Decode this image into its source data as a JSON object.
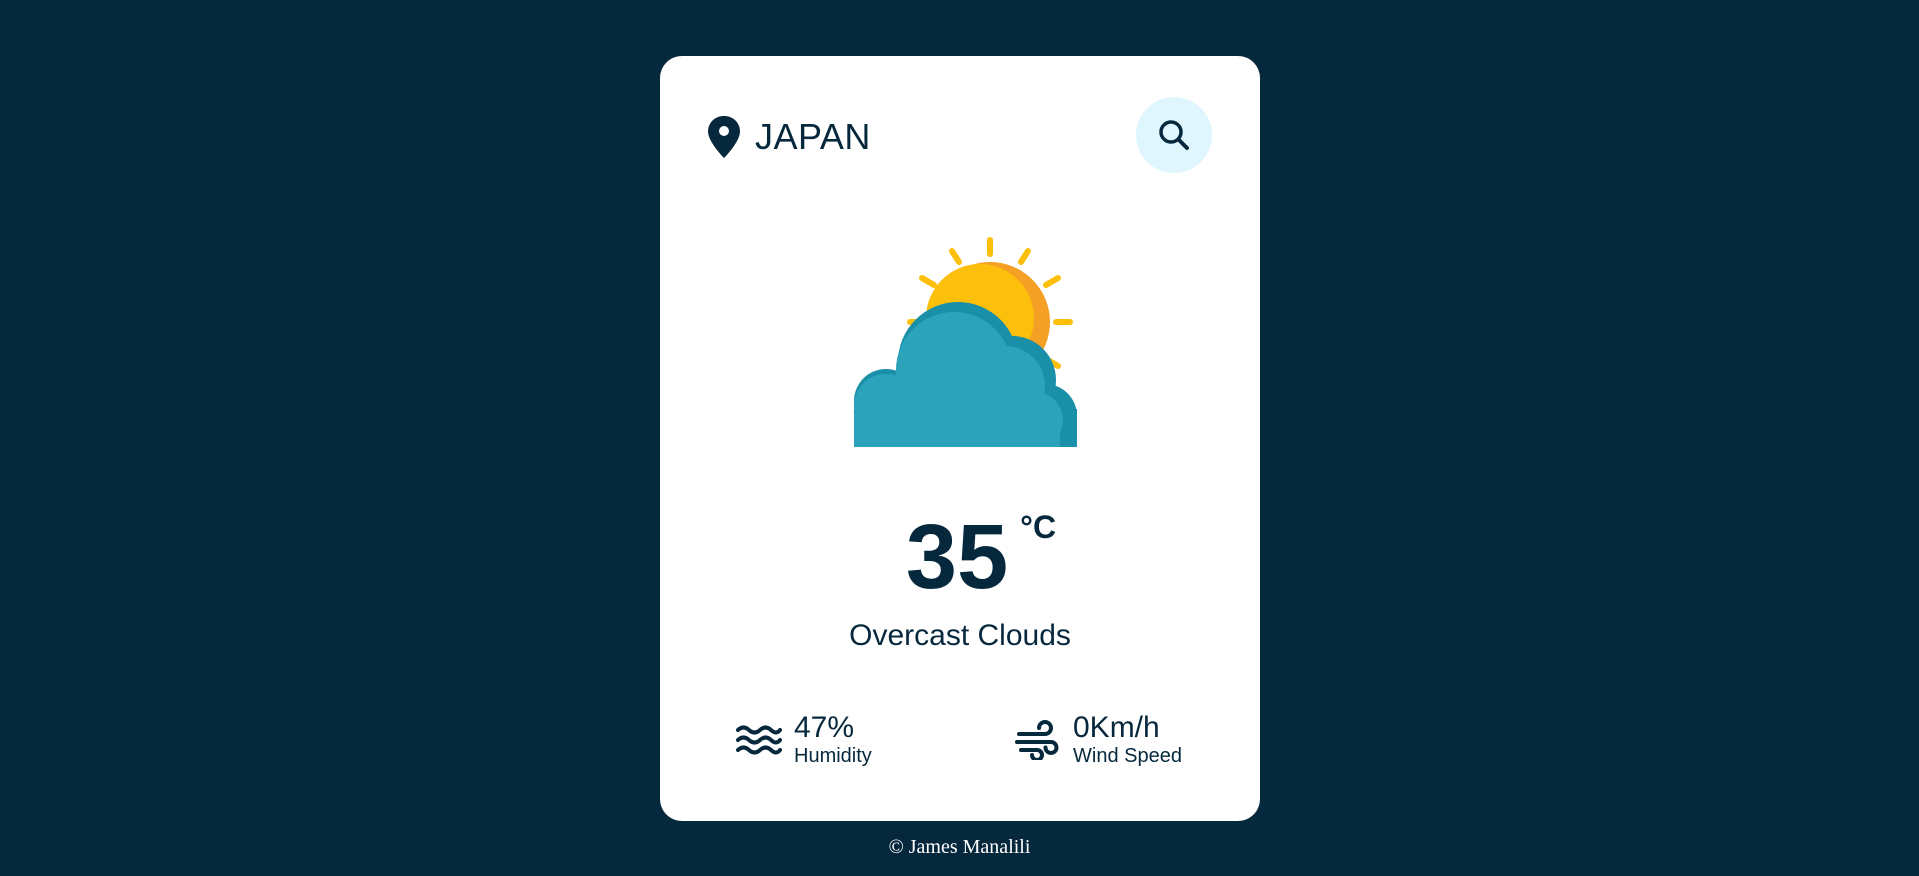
{
  "location": {
    "icon": "location-pin-icon",
    "city": "JAPAN"
  },
  "search": {
    "icon": "search-icon"
  },
  "weather": {
    "icon": "sun-behind-cloud-icon",
    "temperature": "35",
    "unit": "°C",
    "description": "Overcast Clouds"
  },
  "details": {
    "humidity": {
      "icon": "humidity-waves-icon",
      "value": "47%",
      "label": "Humidity"
    },
    "wind": {
      "icon": "wind-icon",
      "value": "0Km/h",
      "label": "Wind Speed"
    }
  },
  "footer": {
    "text": "© James Manalili"
  },
  "colors": {
    "background": "#06283d",
    "card": "#ffffff",
    "text": "#06283d",
    "search_button_bg": "#dff6ff",
    "sun": "#fbbf0c",
    "sun_shade": "#f4a024",
    "cloud": "#2aa3bb",
    "cloud_shade": "#1a8fa8"
  }
}
